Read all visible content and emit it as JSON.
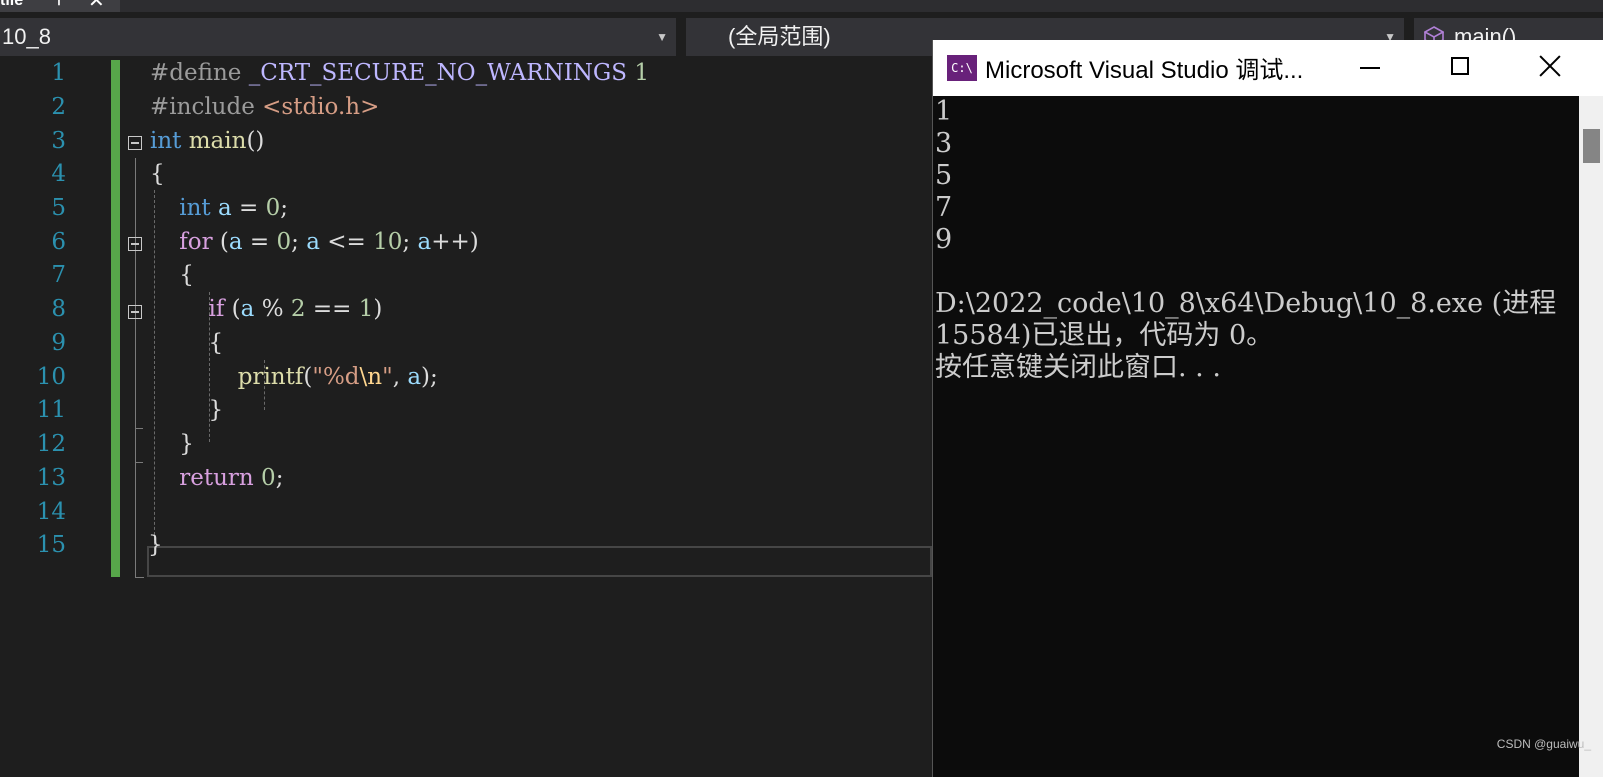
{
  "tab": {
    "label": "tile",
    "pin": "⊤",
    "close": "✕"
  },
  "nav": {
    "project": "10_8",
    "scope": "(全局范围)",
    "member": "main()"
  },
  "editor": {
    "line_numbers": [
      "1",
      "2",
      "3",
      "4",
      "5",
      "6",
      "7",
      "8",
      "9",
      "10",
      "11",
      "12",
      "13",
      "14",
      "15"
    ]
  },
  "console": {
    "title": "Microsoft Visual Studio 调试...",
    "icon_text": "C:\\",
    "output": "1\n3\n5\n7\n9\n\nD:\\2022_code\\10_8\\x64\\Debug\\10_8.exe (进程 15584)已退出，代码为 0。\n按任意键关闭此窗口. . ."
  },
  "watermark": "CSDN @guaiwu_",
  "colors": {
    "change_bar": "#57a64a",
    "line_number": "#2b91af",
    "keyword": "#569cd6"
  }
}
